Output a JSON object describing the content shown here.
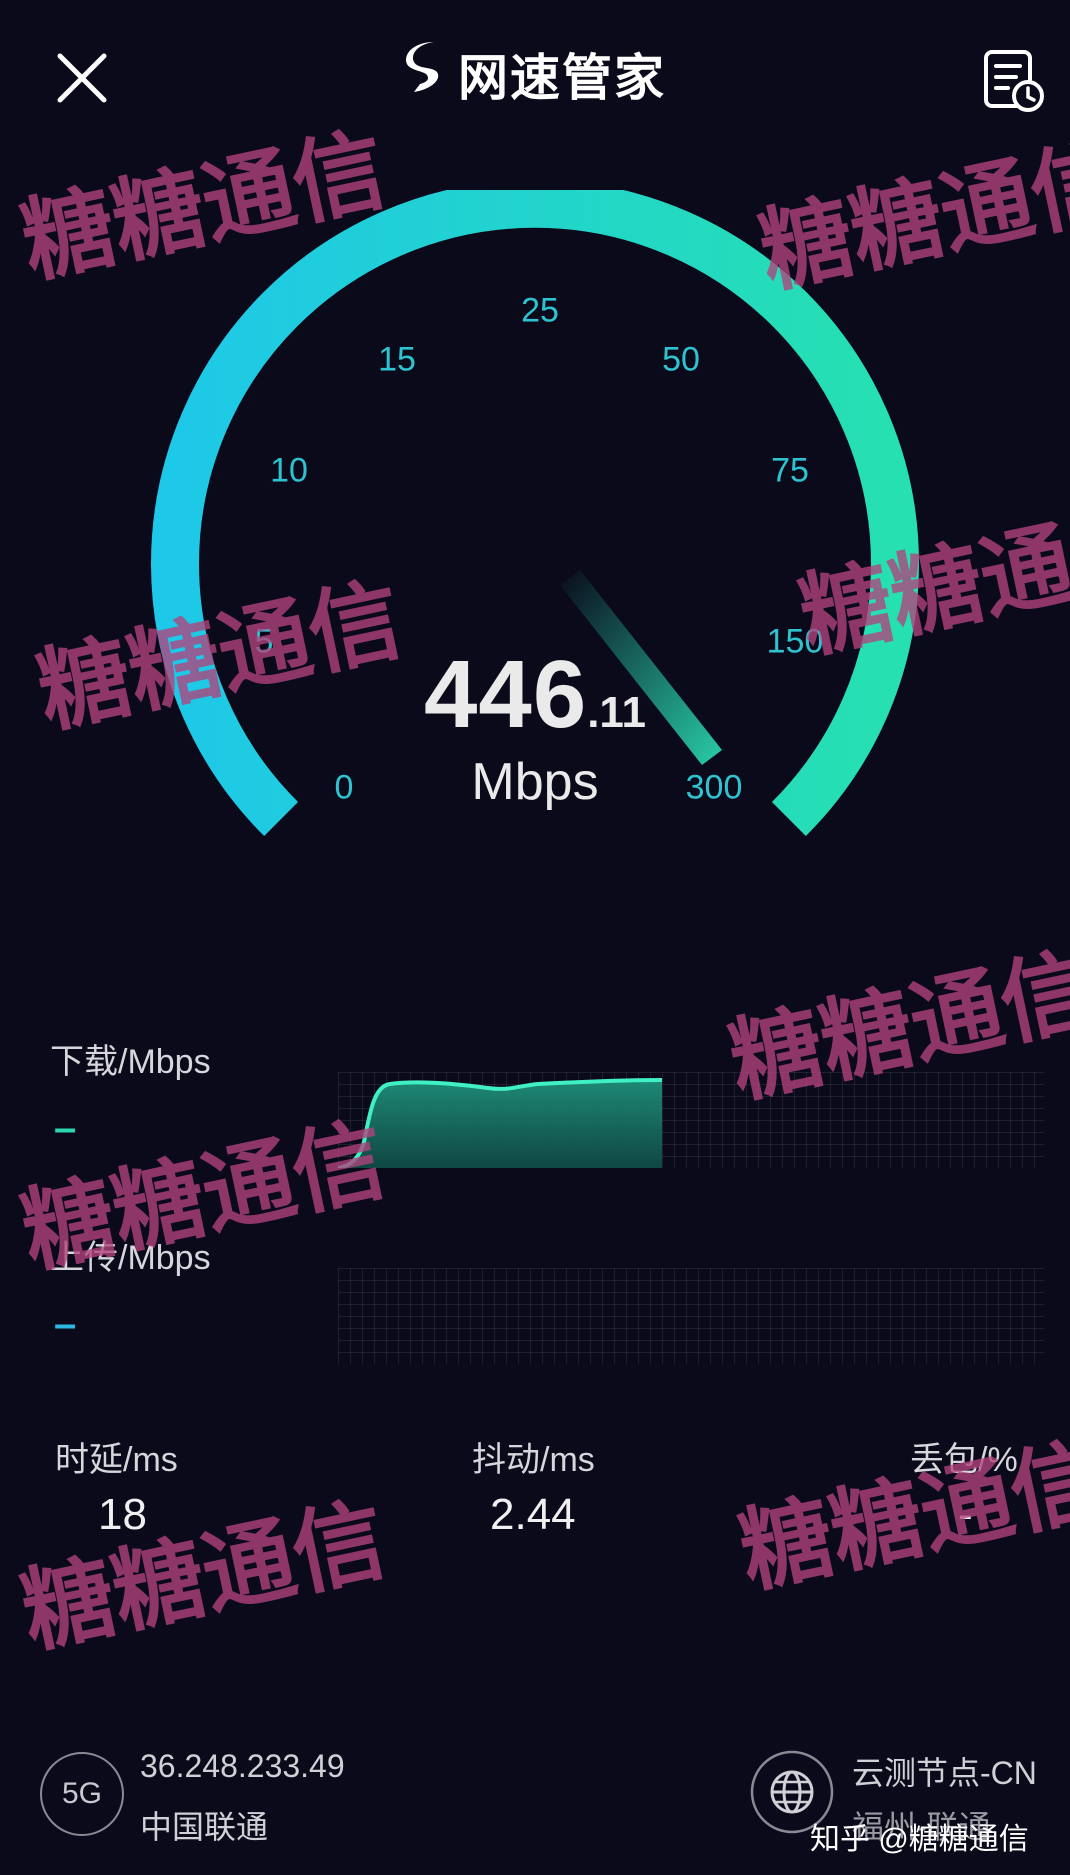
{
  "header": {
    "title": "网速管家",
    "close_icon": "close-icon",
    "history_icon": "history-report-icon"
  },
  "gauge": {
    "tick_labels": [
      "0",
      "5",
      "10",
      "15",
      "25",
      "50",
      "75",
      "150",
      "300"
    ],
    "speed_integer": "446",
    "speed_decimal": ".11",
    "unit": "Mbps",
    "accent_start": "#1ec8e8",
    "accent_end": "#26e0b0"
  },
  "download": {
    "label": "下载/Mbps",
    "value": "–",
    "progress_fraction": 0.39
  },
  "upload": {
    "label": "上传/Mbps",
    "value": "–"
  },
  "stats": {
    "latency": {
      "label": "时延/ms",
      "value": "18"
    },
    "jitter": {
      "label": "抖动/ms",
      "value": "2.44"
    },
    "loss": {
      "label": "丢包/%",
      "value": "-"
    }
  },
  "footer": {
    "network_badge": "5G",
    "ip": "36.248.233.49",
    "carrier": "中国联通",
    "node_line1": "云测节点-CN",
    "node_line2": "福州-联通",
    "globe_icon": "globe-icon"
  },
  "watermark": {
    "text": "糖糖通信",
    "zhihu_credit": "知乎 @糖糖通信",
    "color": "#b2437d"
  }
}
